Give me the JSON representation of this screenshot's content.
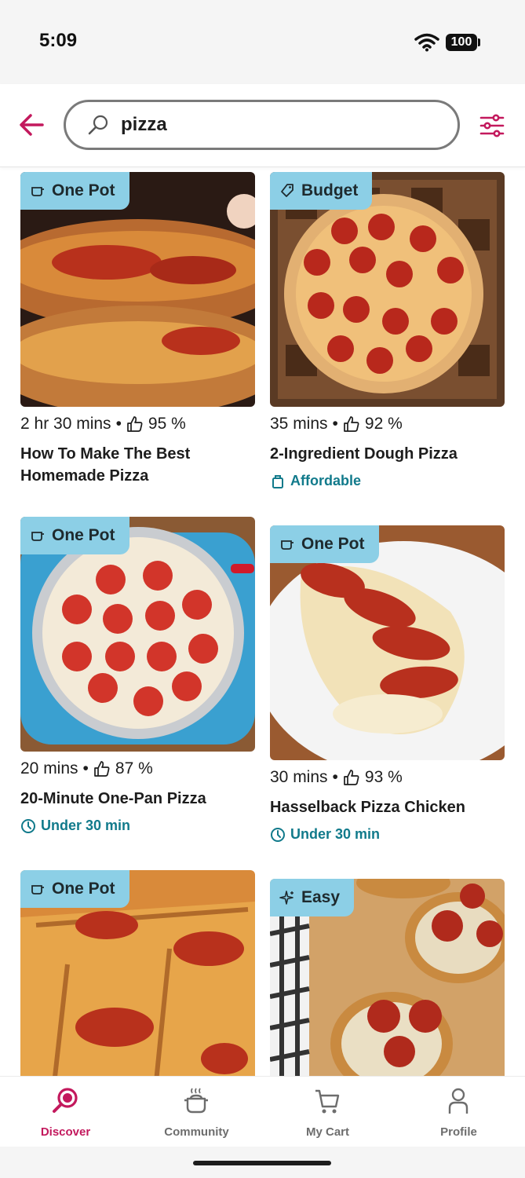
{
  "status_bar": {
    "time": "5:09",
    "battery": "100"
  },
  "header": {
    "back_icon": "arrow-left-icon",
    "search": {
      "value": "pizza",
      "icon": "search-icon"
    },
    "filter_icon": "sliders-icon"
  },
  "colors": {
    "accent": "#c3195d",
    "tag_bg": "#8ccfe6",
    "badge": "#117a8b"
  },
  "recipes": [
    {
      "tag": "One Pot",
      "tag_icon": "pot-icon",
      "time": "2 hr 30 mins",
      "rating": "95 %",
      "title": "How To Make The Best Homemade Pizza",
      "badge": ""
    },
    {
      "tag": "Budget",
      "tag_icon": "price-tag-icon",
      "time": "35 mins",
      "rating": "92 %",
      "title": "2-Ingredient Dough Pizza",
      "badge": "Affordable",
      "badge_icon": "shopping-bag-icon"
    },
    {
      "tag": "One Pot",
      "tag_icon": "pot-icon",
      "time": "20 mins",
      "rating": "87 %",
      "title": "20-Minute One-Pan Pizza",
      "badge": "Under 30 min",
      "badge_icon": "clock-icon"
    },
    {
      "tag": "One Pot",
      "tag_icon": "pot-icon",
      "time": "30 mins",
      "rating": "93 %",
      "title": "Hasselback Pizza Chicken",
      "badge": "Under 30 min",
      "badge_icon": "clock-icon"
    },
    {
      "tag": "One Pot",
      "tag_icon": "pot-icon"
    },
    {
      "tag": "Easy",
      "tag_icon": "sparkle-icon"
    }
  ],
  "tabbar": {
    "items": [
      {
        "label": "Discover",
        "icon": "discover-icon",
        "active": true
      },
      {
        "label": "Community",
        "icon": "community-pot-icon"
      },
      {
        "label": "My Cart",
        "icon": "cart-icon"
      },
      {
        "label": "Profile",
        "icon": "profile-icon"
      }
    ]
  }
}
